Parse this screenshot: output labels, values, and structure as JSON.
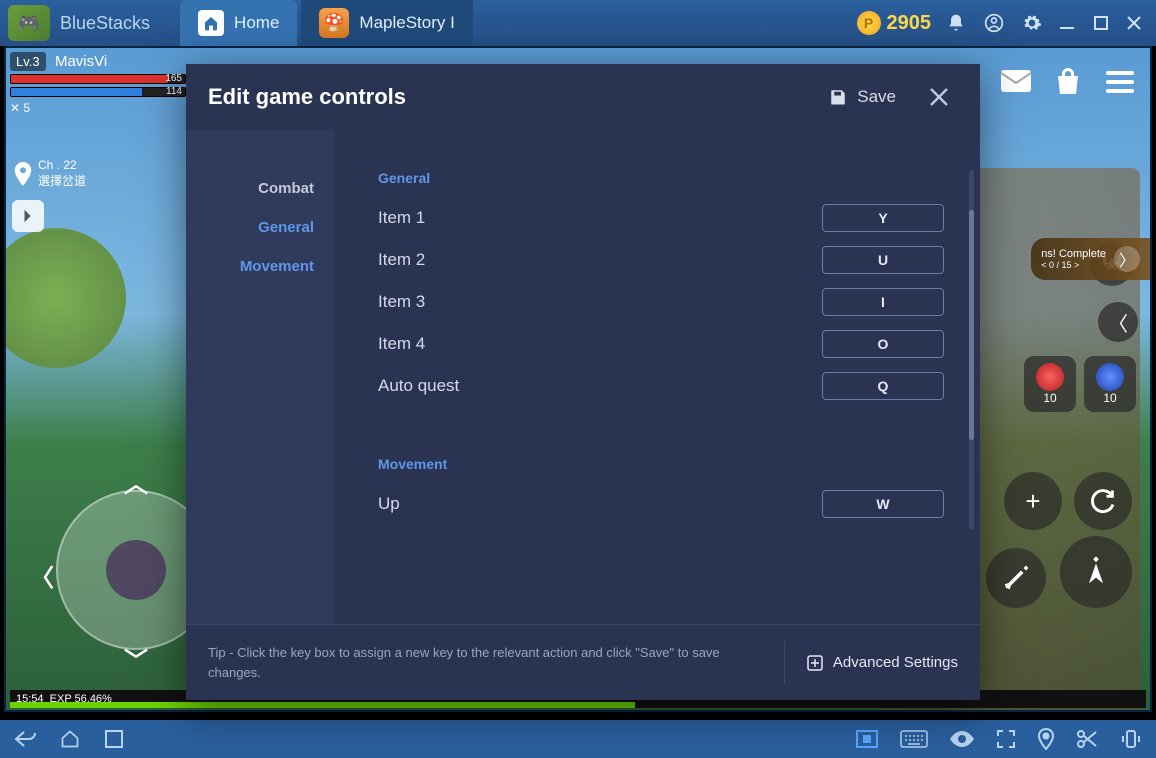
{
  "titlebar": {
    "brand": "BlueStacks",
    "tabs": {
      "home": "Home",
      "game": "MapleStory I"
    },
    "coins": "2905"
  },
  "game_hud": {
    "level": "Lv.3",
    "player_name": "MavisVi",
    "hp": "165",
    "mp": "114",
    "swords": "✕ 5",
    "channel": "Ch . 22",
    "location": "選擇岔道",
    "time": "15:54",
    "exp": "EXP 56.46%",
    "item_qty1": "10",
    "item_qty2": "10",
    "quest": "ns! Complete",
    "quest_progress": "< 0 / 15 >"
  },
  "modal": {
    "title": "Edit game controls",
    "save": "Save",
    "categories": {
      "combat": "Combat",
      "general": "General",
      "movement": "Movement"
    },
    "sections": {
      "general": {
        "heading": "General",
        "rows": [
          {
            "label": "Item 1",
            "key": "Y"
          },
          {
            "label": "Item 2",
            "key": "U"
          },
          {
            "label": "Item 3",
            "key": "I"
          },
          {
            "label": "Item 4",
            "key": "O"
          },
          {
            "label": "Auto quest",
            "key": "Q"
          }
        ]
      },
      "movement": {
        "heading": "Movement",
        "rows": [
          {
            "label": "Up",
            "key": "W"
          }
        ]
      }
    },
    "tip": "Tip - Click the key box to assign a new key to the relevant action and click \"Save\" to save changes.",
    "advanced": "Advanced Settings"
  }
}
